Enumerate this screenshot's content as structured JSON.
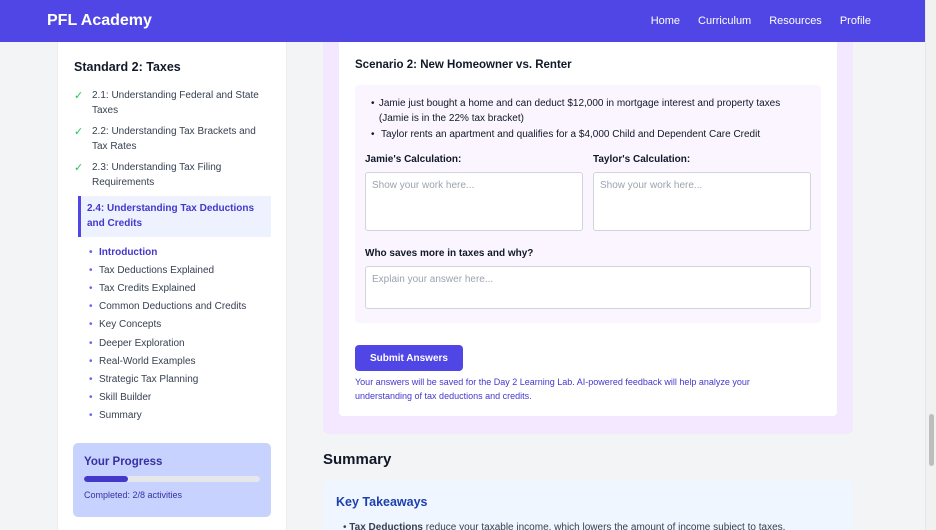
{
  "nav": {
    "brand": "PFL Academy",
    "links": [
      "Home",
      "Curriculum",
      "Resources",
      "Profile"
    ]
  },
  "sidebar": {
    "title": "Standard 2: Taxes",
    "completed_lessons": [
      "2.1: Understanding Federal and State Taxes",
      "2.2: Understanding Tax Brackets and Tax Rates",
      "2.3: Understanding Tax Filing Requirements"
    ],
    "check_icon": "✓",
    "active_lesson": "2.4: Understanding Tax Deductions and Credits",
    "sections": [
      "Introduction",
      "Tax Deductions Explained",
      "Tax Credits Explained",
      "Common Deductions and Credits",
      "Key Concepts",
      "Deeper Exploration",
      "Real-World Examples",
      "Strategic Tax Planning",
      "Skill Builder",
      "Summary"
    ],
    "active_section": "Introduction",
    "progress": {
      "title": "Your Progress",
      "completed": 2,
      "total": 8,
      "text": "Completed: 2/8 activities"
    }
  },
  "scenario": {
    "title": "Scenario 2: New Homeowner vs. Renter",
    "bullets": [
      "Jamie just bought a home and can deduct $12,000 in mortgage interest and property taxes (Jamie is in the 22% tax bracket)",
      "Taylor rents an apartment and qualifies for a $4,000 Child and Dependent Care Credit"
    ],
    "jamie_label": "Jamie's Calculation:",
    "taylor_label": "Taylor's Calculation:",
    "work_placeholder": "Show your work here...",
    "question_label": "Who saves more in taxes and why?",
    "answer_placeholder": "Explain your answer here...",
    "submit_label": "Submit Answers",
    "note": "Your answers will be saved for the Day 2 Learning Lab. AI-powered feedback will help analyze your understanding of tax deductions and credits."
  },
  "summary": {
    "heading": "Summary",
    "takeaways_title": "Key Takeaways",
    "first_item_bold": "Tax Deductions",
    "first_item_rest": " reduce your taxable income, which lowers the amount of income subject to taxes."
  },
  "colors": {
    "brand": "#4f46e5",
    "check": "#22c55e",
    "panel": "#f3e8ff"
  }
}
